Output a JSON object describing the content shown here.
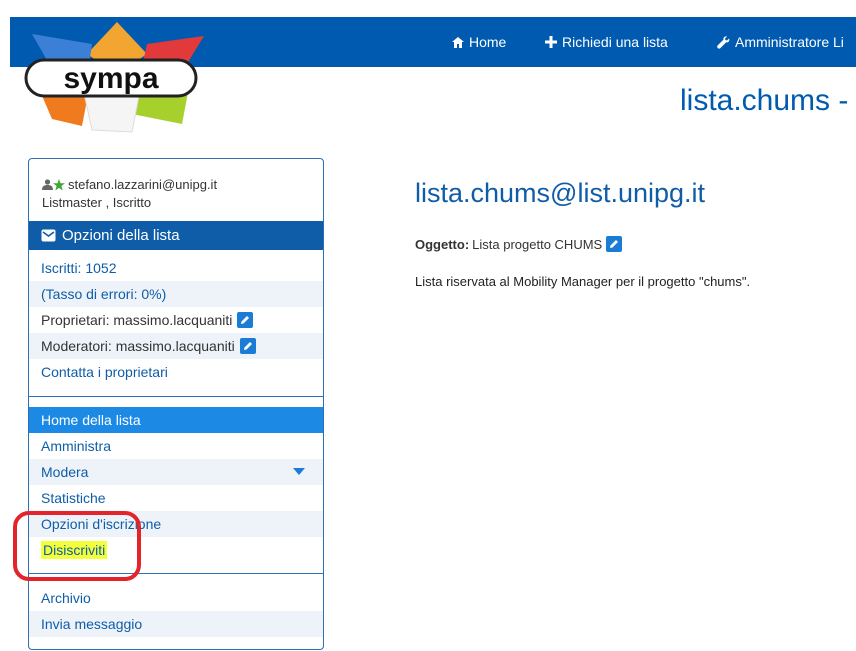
{
  "topnav": {
    "home": "Home",
    "request_list": "Richiedi una lista",
    "admin": "Amministratore Li"
  },
  "logo": {
    "text": "sympa"
  },
  "header": {
    "title": "lista.chums -"
  },
  "sidebar": {
    "user_email": "stefano.lazzarini@unipg.it",
    "user_roles": "Listmaster , Iscritto",
    "options_title": "Opzioni della lista",
    "info": [
      {
        "label": "Iscritti: 1052"
      },
      {
        "label": "(Tasso di errori: 0%)"
      },
      {
        "label": "Proprietari: massimo.lacquaniti"
      },
      {
        "label": "Moderatori: massimo.lacquaniti"
      },
      {
        "label": "Contatta i proprietari"
      }
    ],
    "nav": [
      {
        "label": "Home della lista"
      },
      {
        "label": "Amministra"
      },
      {
        "label": "Modera"
      },
      {
        "label": "Statistiche"
      },
      {
        "label": "Opzioni d'iscrizione"
      },
      {
        "label": "Disiscriviti"
      }
    ],
    "archive": [
      {
        "label": "Archivio"
      },
      {
        "label": "Invia messaggio"
      }
    ]
  },
  "main": {
    "title": "lista.chums@list.unipg.it",
    "subject_label": "Oggetto:",
    "subject_value": "Lista progetto CHUMS",
    "description": "Lista riservata al Mobility Manager per il progetto \"chums\"."
  },
  "colors": {
    "primary": "#005bb0",
    "active_item": "#1c8ae5",
    "highlight": "#f2ff3a",
    "annotation": "#e3242b"
  }
}
